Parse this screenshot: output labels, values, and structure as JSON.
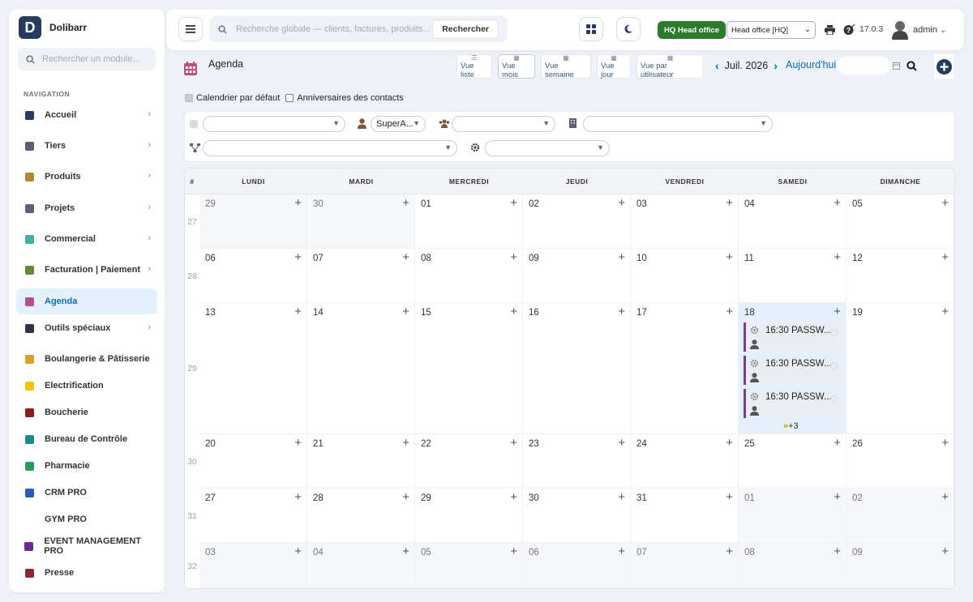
{
  "brand": {
    "name": "Dolibarr",
    "logo": "D"
  },
  "sidebar": {
    "search_placeholder": "Rechercher un module...",
    "nav_title": "NAVIGATION",
    "items": [
      {
        "label": "Accueil",
        "icon": "home-icon",
        "color": "#263c5c"
      },
      {
        "label": "Tiers",
        "icon": "building-icon",
        "color": "#5c5f7a"
      },
      {
        "label": "Produits",
        "icon": "cube-icon",
        "color": "#b0892c"
      },
      {
        "label": "Projets",
        "icon": "project-icon",
        "color": "#5c5f7a"
      },
      {
        "label": "Commercial",
        "icon": "briefcase-icon",
        "color": "#44b0a0"
      },
      {
        "label": "Facturation | Paiement",
        "icon": "invoice-icon",
        "color": "#5e8a3a"
      },
      {
        "label": "Agenda",
        "icon": "calendar-icon",
        "color": "#b3508a"
      },
      {
        "label": "Outils spéciaux",
        "icon": "tools-icon",
        "color": "#334"
      },
      {
        "label": "Boulangerie & Pâtisserie",
        "icon": "bread-icon",
        "color": "#d9a32a"
      },
      {
        "label": "Electrification",
        "icon": "bolt-icon",
        "color": "#f2c40f"
      },
      {
        "label": "Boucherie",
        "icon": "knife-icon",
        "color": "#8a1c1c"
      },
      {
        "label": "Bureau de Contrôle",
        "icon": "shield-check-icon",
        "color": "#1f8a8a"
      },
      {
        "label": "Pharmacie",
        "icon": "cross-icon",
        "color": "#2a9a5a"
      },
      {
        "label": "CRM PRO",
        "icon": "funnel-icon",
        "color": "#2a5ac0"
      },
      {
        "label": "GYM PRO",
        "icon": "dumbbell-icon",
        "color": "#ffffff"
      },
      {
        "label": "EVENT MANAGEMENT PRO",
        "icon": "ticket-icon",
        "color": "#6a2a8a"
      },
      {
        "label": "Presse",
        "icon": "gift-icon",
        "color": "#8a2a2a"
      }
    ]
  },
  "topbar": {
    "search_placeholder": "Recherche globale — clients, factures, produits...",
    "search_button": "Rechercher",
    "entity_badge": "HQ Head office",
    "entity_select": "Head office [HQ]",
    "version": "17.0.3",
    "user": "admin"
  },
  "agenda": {
    "title": "Agenda",
    "views": [
      "Vue liste",
      "Vue mois",
      "Vue semaine",
      "Vue jour",
      "Vue par utilisateur"
    ],
    "active_view": "Vue mois",
    "month": "Juil. 2026",
    "today": "Aujourd'hui",
    "checks": [
      "Calendrier par défaut",
      "Anniversaires des contacts"
    ],
    "user_filter": "SuperA...",
    "calendar": {
      "corner": "#",
      "days": [
        "LUNDI",
        "MARDI",
        "MERCREDI",
        "JEUDI",
        "VENDREDI",
        "SAMEDI",
        "DIMANCHE"
      ],
      "weeks": [
        {
          "num": "27",
          "days": [
            "29",
            "30",
            "01",
            "02",
            "03",
            "04",
            "05"
          ]
        },
        {
          "num": "28",
          "days": [
            "06",
            "07",
            "08",
            "09",
            "10",
            "11",
            "12"
          ]
        },
        {
          "num": "29",
          "days": [
            "13",
            "14",
            "15",
            "16",
            "17",
            "18",
            "19"
          ]
        },
        {
          "num": "30",
          "days": [
            "20",
            "21",
            "22",
            "23",
            "24",
            "25",
            "26"
          ]
        },
        {
          "num": "31",
          "days": [
            "27",
            "28",
            "29",
            "30",
            "31",
            "01",
            "02"
          ]
        },
        {
          "num": "32",
          "days": [
            "03",
            "04",
            "05",
            "06",
            "07",
            "08",
            "09"
          ]
        }
      ],
      "events": [
        "16:30 PASSW...",
        "16:30 PASSW...",
        "16:30 PASSW..."
      ],
      "more": "+3"
    }
  }
}
